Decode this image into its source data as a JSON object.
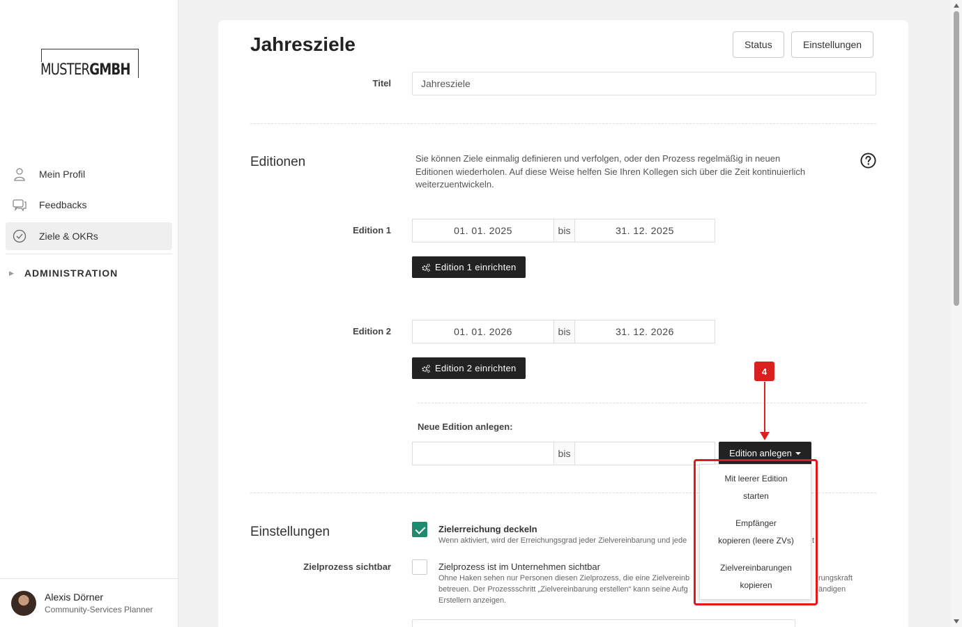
{
  "sidebar": {
    "logo": {
      "part1": "MUSTER",
      "part2": "GMBH"
    },
    "items": [
      {
        "label": "Mein Profil",
        "icon": "user-icon"
      },
      {
        "label": "Feedbacks",
        "icon": "chat-icon"
      },
      {
        "label": "Ziele & OKRs",
        "icon": "check-circle-icon",
        "active": true
      }
    ],
    "admin_label": "ADMINISTRATION",
    "user": {
      "name": "Alexis Dörner",
      "role": "Community-Services Planner"
    }
  },
  "header": {
    "title": "Jahresziele",
    "status_button": "Status",
    "settings_button": "Einstellungen"
  },
  "form": {
    "titel_label": "Titel",
    "titel_value": "Jahresziele"
  },
  "editionen": {
    "section_title": "Editionen",
    "description": "Sie können Ziele einmalig definieren und verfolgen, oder den Prozess regelmäßig in neuen Editionen wiederholen. Auf diese Weise helfen Sie Ihren Kollegen sich über die Zeit kontinuierlich weiterzuentwickeln.",
    "bis": "bis",
    "items": [
      {
        "label": "Edition 1",
        "start": "01. 01. 2025",
        "end": "31. 12. 2025",
        "button": "Edition 1 einrichten"
      },
      {
        "label": "Edition 2",
        "start": "01. 01. 2026",
        "end": "31. 12. 2026",
        "button": "Edition 2 einrichten"
      }
    ],
    "neue_label": "Neue Edition anlegen:",
    "neue_start": "",
    "neue_end": "",
    "anlegen_button": "Edition anlegen",
    "dropdown": [
      {
        "line1": "Mit leerer Edition",
        "line2": "starten"
      },
      {
        "line1": "Empfänger",
        "line2": "kopieren (leere ZVs)"
      },
      {
        "line1": "Zielvereinbarungen",
        "line2": "kopieren"
      }
    ]
  },
  "annotation": {
    "badge": "4",
    "color": "#d9201e"
  },
  "einstellungen": {
    "section_title": "Einstellungen",
    "deckeln": {
      "title": "Zielerreichung deckeln",
      "desc": "Wenn aktiviert, wird der Erreichungsgrad jeder Zielvereinbarung und jede",
      "desc_tail": "t",
      "checked": true
    },
    "sichtbar": {
      "label": "Zielprozess sichtbar",
      "title": "Zielprozess ist im Unternehmen sichtbar",
      "desc1_a": "Ohne Haken sehen nur Personen diesen Zielprozess, die eine Zielvereinb",
      "desc1_b": "rungskraft",
      "desc2_a": "betreuen. Der Prozessschritt „Zielvereinbarung erstellen“ kann seine Aufg",
      "desc2_b": "ändigen",
      "desc3": "Erstellern anzeigen.",
      "checked": false
    }
  },
  "colors": {
    "accent": "#1f8a70",
    "dark_button": "#222222"
  }
}
